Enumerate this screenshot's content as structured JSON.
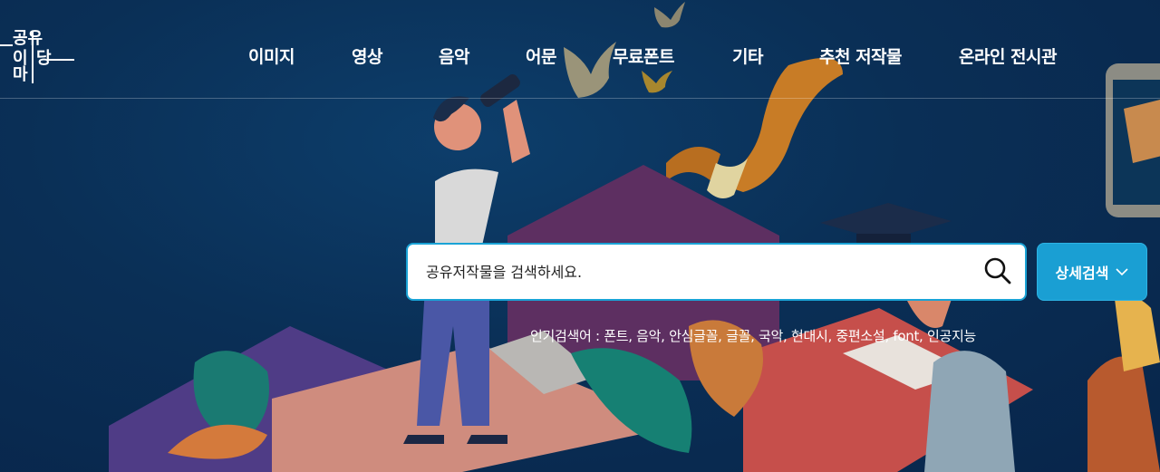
{
  "logo": {
    "text": "공유마당"
  },
  "nav": {
    "items": [
      {
        "label": "이미지"
      },
      {
        "label": "영상"
      },
      {
        "label": "음악"
      },
      {
        "label": "어문"
      },
      {
        "label": "무료폰트"
      },
      {
        "label": "기타"
      },
      {
        "label": "추천 저작물"
      },
      {
        "label": "온라인 전시관"
      }
    ]
  },
  "search": {
    "placeholder": "공유저작물을 검색하세요.",
    "value": "",
    "button_icon": "search-icon"
  },
  "advanced_search": {
    "label": "상세검색",
    "icon": "chevron-down-icon"
  },
  "popular": {
    "prefix": "인기검색어 : ",
    "keywords": [
      "폰트",
      "음악",
      "안심글꼴",
      "글꼴",
      "국악",
      "현대시",
      "중편소설",
      "font",
      "인공지능"
    ]
  },
  "colors": {
    "background": "#0a2f56",
    "accent": "#1a9fd3",
    "search_border": "#1aa3d6"
  }
}
